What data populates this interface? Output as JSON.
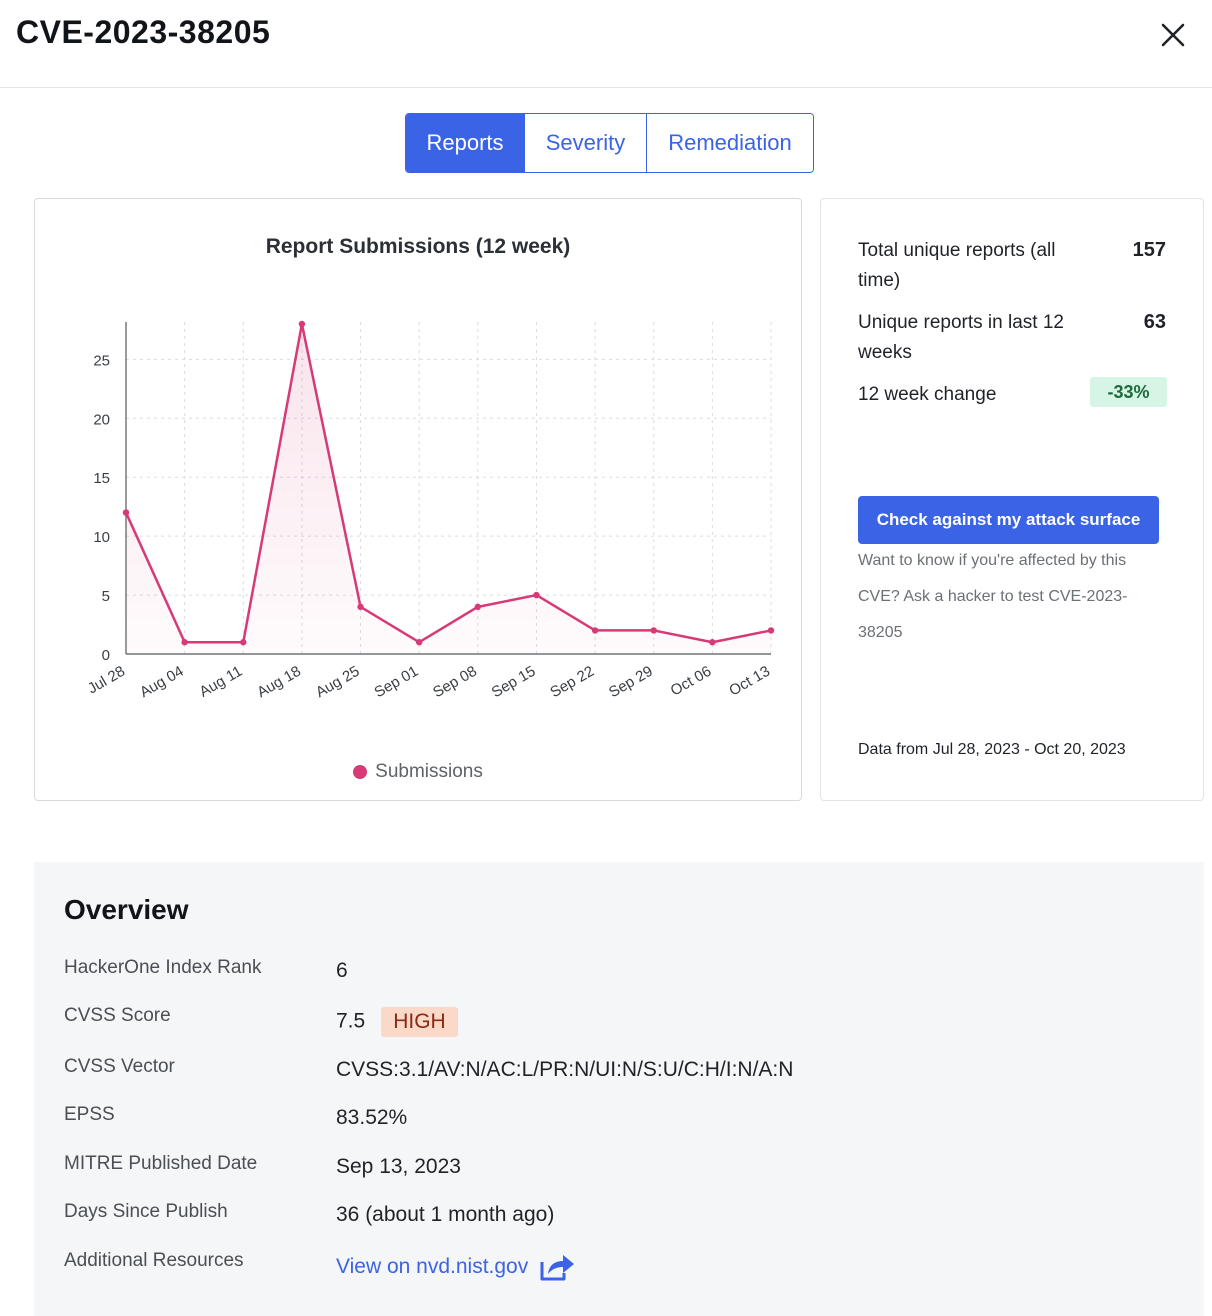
{
  "header": {
    "title": "CVE-2023-38205"
  },
  "tabs": [
    {
      "label": "Reports",
      "active": true
    },
    {
      "label": "Severity",
      "active": false
    },
    {
      "label": "Remediation",
      "active": false
    }
  ],
  "chart": {
    "title": "Report Submissions (12 week)",
    "legend_label": "Submissions",
    "series_color": "#d63a77"
  },
  "chart_data": {
    "type": "area",
    "title": "Report Submissions (12 week)",
    "xlabel": "",
    "ylabel": "",
    "categories": [
      "Jul 28",
      "Aug 04",
      "Aug 11",
      "Aug 18",
      "Aug 25",
      "Sep 01",
      "Sep 08",
      "Sep 15",
      "Sep 22",
      "Sep 29",
      "Oct 06",
      "Oct 13"
    ],
    "series": [
      {
        "name": "Submissions",
        "values": [
          12,
          1,
          1,
          28,
          4,
          1,
          4,
          5,
          2,
          2,
          1,
          2
        ]
      }
    ],
    "yticks": [
      0,
      5,
      10,
      15,
      20,
      25
    ],
    "ylim": [
      0,
      28
    ],
    "grid": true,
    "legend_position": "bottom"
  },
  "stats": {
    "total_label": "Total unique reports (all time)",
    "total_value": "157",
    "recent_label": "Unique reports in last 12 weeks",
    "recent_value": "63",
    "change_label": "12 week change",
    "change_value": "-33%",
    "cta_label": "Check against my attack surface",
    "cta_help": "Want to know if you're affected by this CVE? Ask a hacker to test CVE-2023-38205",
    "data_range": "Data from Jul 28, 2023 - Oct 20, 2023"
  },
  "overview": {
    "title": "Overview",
    "rows": [
      {
        "label": "HackerOne Index Rank",
        "value": "6"
      },
      {
        "label": "CVSS Score",
        "value": "7.5",
        "badge": "HIGH"
      },
      {
        "label": "CVSS Vector",
        "value": "CVSS:3.1/AV:N/AC:L/PR:N/UI:N/S:U/C:H/I:N/A:N"
      },
      {
        "label": "EPSS",
        "value": "83.52%"
      },
      {
        "label": "MITRE Published Date",
        "value": "Sep 13, 2023"
      },
      {
        "label": "Days Since Publish",
        "value": "36 (about 1 month ago)"
      },
      {
        "label": "Additional Resources",
        "value": "View on nvd.nist.gov"
      }
    ]
  },
  "colors": {
    "accent": "#3b63e6",
    "series": "#d63a77",
    "badge_high_bg": "#fbd9c9",
    "change_bg": "#d6f5e4"
  }
}
